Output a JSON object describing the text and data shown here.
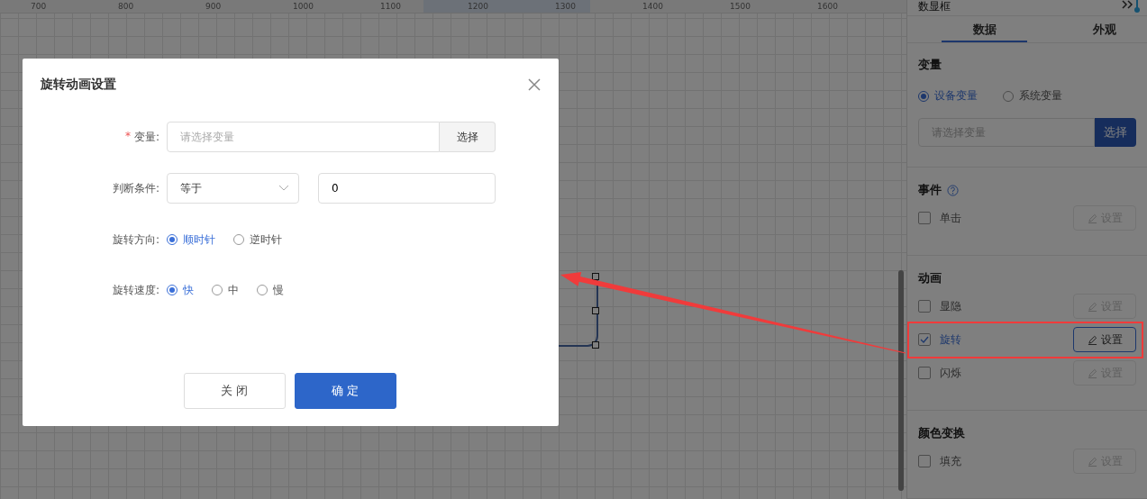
{
  "ruler": {
    "ticks": [
      "700",
      "800",
      "900",
      "1000",
      "1100",
      "1200",
      "1300",
      "1400",
      "1500",
      "1600"
    ]
  },
  "panel": {
    "title": "数显框",
    "tabs": [
      {
        "label": "数据",
        "selected": true
      },
      {
        "label": "外观",
        "selected": false
      }
    ],
    "variable": {
      "heading": "变量",
      "options": [
        {
          "label": "设备变量",
          "selected": true
        },
        {
          "label": "系统变量",
          "selected": false
        }
      ],
      "placeholder": "请选择变量",
      "button": "选择"
    },
    "sections": [
      {
        "heading": "事件",
        "help": true,
        "items": [
          {
            "label": "单击",
            "checked": false,
            "highlighted": false,
            "button": "设置"
          }
        ]
      },
      {
        "heading": "动画",
        "help": false,
        "items": [
          {
            "label": "显隐",
            "checked": false,
            "highlighted": false,
            "button": "设置"
          },
          {
            "label": "旋转",
            "checked": true,
            "highlighted": true,
            "button": "设置"
          },
          {
            "label": "闪烁",
            "checked": false,
            "highlighted": false,
            "button": "设置"
          }
        ]
      },
      {
        "heading": "颜色变换",
        "help": false,
        "items": [
          {
            "label": "填充",
            "checked": false,
            "highlighted": false,
            "button": "设置"
          }
        ]
      }
    ]
  },
  "dialog": {
    "title": "旋转动画设置",
    "fields": [
      {
        "kind": "variable",
        "label": "变量:",
        "required_mark": "*",
        "placeholder": "请选择变量",
        "button": "选择"
      },
      {
        "kind": "condition",
        "label": "判断条件:",
        "select": "等于",
        "value": "0"
      },
      {
        "kind": "radio",
        "label": "旋转方向:",
        "options": [
          {
            "label": "顺时针",
            "selected": true
          },
          {
            "label": "逆时针",
            "selected": false
          }
        ]
      },
      {
        "kind": "radio",
        "label": "旋转速度:",
        "options": [
          {
            "label": "快",
            "selected": true
          },
          {
            "label": "中",
            "selected": false
          },
          {
            "label": "慢",
            "selected": false
          }
        ]
      }
    ],
    "buttons": [
      {
        "label": "关 闭",
        "kind": "default"
      },
      {
        "label": "确 定",
        "kind": "primary"
      }
    ]
  }
}
